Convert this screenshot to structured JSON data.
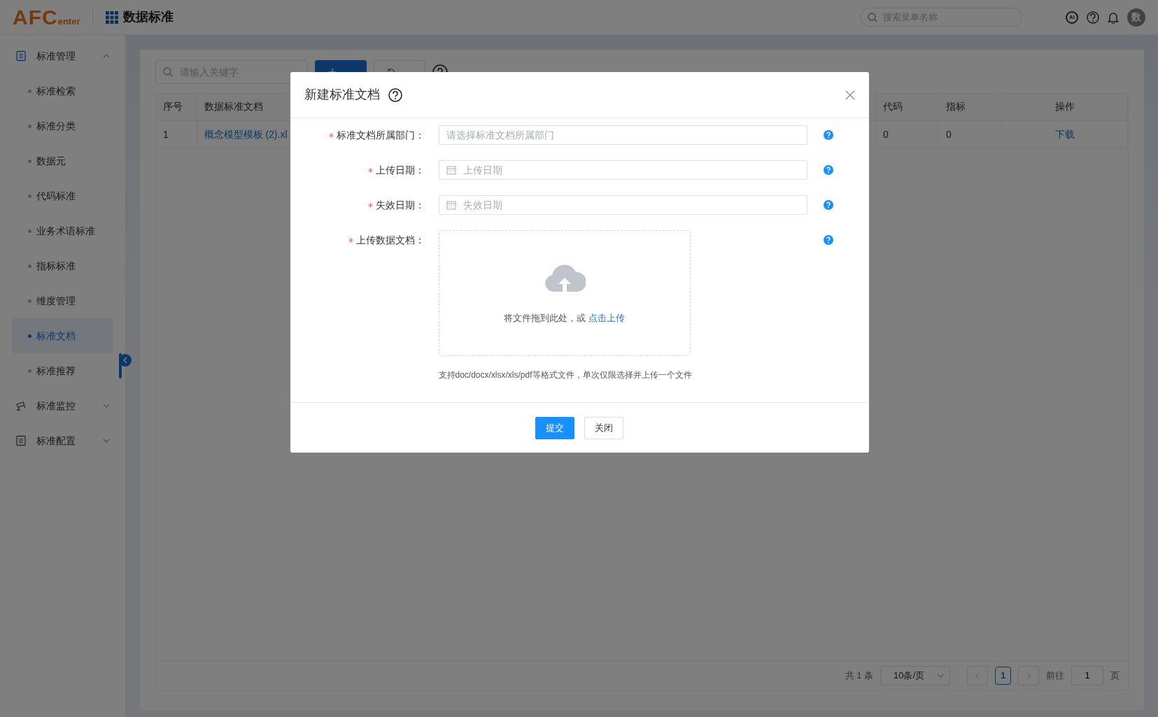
{
  "header": {
    "logo": {
      "main": "AFC",
      "sub": "enter"
    },
    "title": "数据标准",
    "search": {
      "placeholder": "搜索菜单名称"
    },
    "ai_badge": "AI",
    "avatar": "数"
  },
  "sidebar": {
    "groups": [
      {
        "label": "标准管理",
        "expanded": true,
        "children": [
          {
            "label": "标准检索",
            "selected": false
          },
          {
            "label": "标准分类",
            "selected": false
          },
          {
            "label": "数据元",
            "selected": false
          },
          {
            "label": "代码标准",
            "selected": false
          },
          {
            "label": "业务术语标准",
            "selected": false
          },
          {
            "label": "指标标准",
            "selected": false
          },
          {
            "label": "维度管理",
            "selected": false
          },
          {
            "label": "标准文档",
            "selected": true
          },
          {
            "label": "标准推荐",
            "selected": false
          }
        ]
      },
      {
        "label": "标准监控",
        "expanded": false
      },
      {
        "label": "标准配置",
        "expanded": false
      }
    ]
  },
  "toolbar": {
    "search": {
      "placeholder": "请输入关键字"
    },
    "buttons": [
      {
        "kind": "primary"
      },
      {
        "kind": "default"
      }
    ]
  },
  "table": {
    "columns": [
      "序号",
      "数据标准文档",
      "代码",
      "指标",
      "操作"
    ],
    "rows": [
      {
        "cells": [
          "1",
          "概念模型模板 (2).xl",
          "0",
          "0",
          "下载"
        ]
      }
    ]
  },
  "pagination": {
    "total": "共 1 条",
    "page_size": "10条/页",
    "pages": [
      {
        "label": "1",
        "selected": true
      }
    ],
    "goto_label": "前往",
    "goto_value": "1",
    "goto_suffix": "页"
  },
  "dialog": {
    "title": "新建标准文档",
    "fields": [
      {
        "kind": "select",
        "label": "标准文档所属部门：",
        "required": true,
        "placeholder": "请选择标准文档所属部门"
      },
      {
        "kind": "date",
        "label": "上传日期：",
        "required": true,
        "placeholder": "上传日期"
      },
      {
        "kind": "date",
        "label": "失效日期：",
        "required": true,
        "placeholder": "失效日期"
      },
      {
        "kind": "upload",
        "label": "上传数据文档：",
        "required": true,
        "drop_text": "将文件拖到此处，或",
        "link": "点击上传",
        "hint": "支持doc/docx/xlsx/xls/pdf等格式文件，单次仅限选择并上传一个文件"
      }
    ],
    "buttons": [
      {
        "label": "提交",
        "kind": "primary"
      },
      {
        "label": "关闭",
        "kind": "default"
      }
    ]
  }
}
